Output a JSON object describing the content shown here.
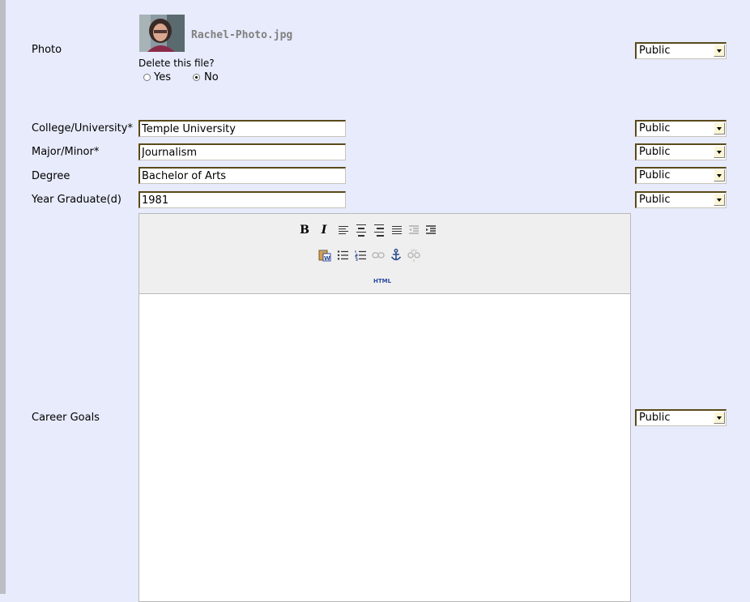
{
  "rows": {
    "photo": {
      "label": "Photo",
      "filename": "Rachel-Photo.jpg",
      "thumbnail_icon": "user-photo-thumbnail",
      "delete_question": "Delete this file?",
      "options": [
        "Yes",
        "No"
      ],
      "selected": "No",
      "privacy": "Public"
    },
    "college": {
      "label": "College/University*",
      "value": "Temple University",
      "privacy": "Public"
    },
    "major": {
      "label": "Major/Minor*",
      "value": "Journalism",
      "privacy": "Public"
    },
    "degree": {
      "label": "Degree",
      "value": "Bachelor of Arts",
      "privacy": "Public"
    },
    "year": {
      "label": "Year Graduate(d)",
      "value": "1981",
      "privacy": "Public"
    },
    "career": {
      "label": "Career Goals",
      "value": "",
      "privacy": "Public"
    }
  },
  "editor": {
    "toolbar_row1": [
      "bold-icon",
      "italic-icon",
      "align-left-icon",
      "align-center-icon",
      "align-right-icon",
      "justify-icon",
      "outdent-icon",
      "indent-icon"
    ],
    "toolbar_row2": [
      "paste-from-word-icon",
      "bullet-list-icon",
      "numbered-list-icon",
      "link-icon",
      "anchor-icon",
      "unlink-icon"
    ],
    "html_button": "HTML",
    "bold_glyph": "B",
    "italic_glyph": "I"
  }
}
